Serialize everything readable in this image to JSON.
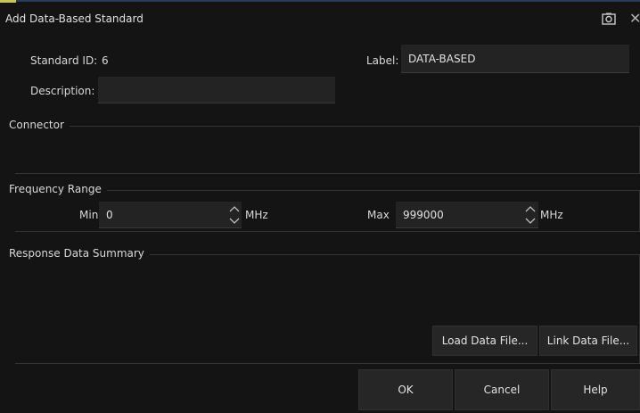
{
  "dialog": {
    "title": "Add Data-Based Standard"
  },
  "fields": {
    "standard_id_label": "Standard ID:",
    "standard_id_value": "6",
    "label_label": "Label:",
    "label_value": "DATA-BASED",
    "description_label": "Description:",
    "description_value": ""
  },
  "groups": {
    "connector": "Connector",
    "frequency_range": "Frequency Range",
    "response_summary": "Response Data Summary"
  },
  "frequency": {
    "min_label": "Min",
    "min_value": "0",
    "max_label": "Max",
    "max_value": "999000",
    "unit": "MHz"
  },
  "buttons": {
    "load": "Load Data File...",
    "link": "Link Data File...",
    "ok": "OK",
    "cancel": "Cancel",
    "help": "Help"
  },
  "icons": {
    "camera": "camera-icon",
    "close": "close-icon",
    "spin_up": "chevron-up-icon",
    "spin_down": "chevron-down-icon"
  },
  "colors": {
    "background": "#141414",
    "field": "#232323",
    "accent": "#c8c84a"
  }
}
